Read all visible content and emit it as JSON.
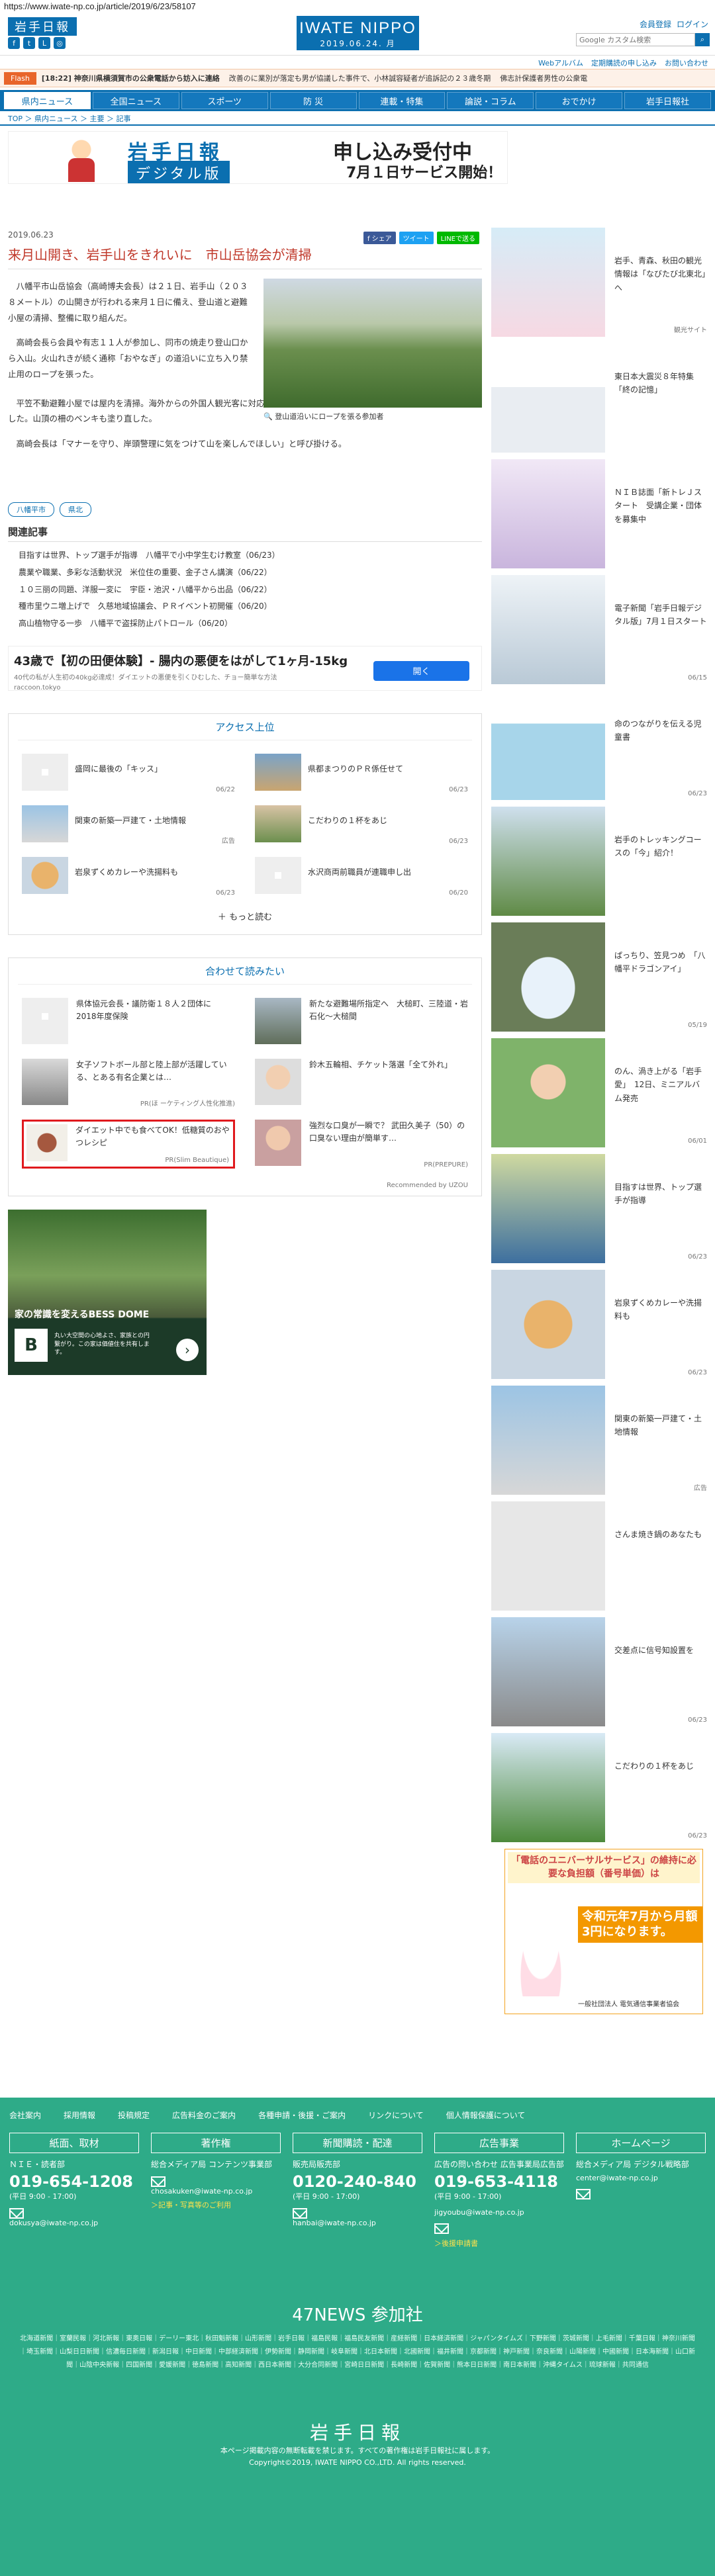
{
  "url": "https://www.iwate-np.co.jp/article/2019/6/23/58107",
  "header": {
    "logo": "岩手日報",
    "brand": "IWATE NIPPO",
    "brand_date": "2019.06.24. 月",
    "links": [
      "会員登録",
      "ログイン"
    ],
    "search_placeholder": "Google カスタム検索",
    "sub_links": [
      "Webアルバム",
      "定期購読の申し込み",
      "お問い合わせ"
    ]
  },
  "flash": {
    "tag": "Flash",
    "items": [
      "[18:22] 神奈川県横須賀市の公衆電話から妨入に連絡",
      "改善のに業別が落定も男が協議した事件で、小林誠容疑者が追訴記の２３歳冬期",
      "佛志計保護者男性の公衆電"
    ]
  },
  "nav": [
    "県内ニュース",
    "全国ニュース",
    "スポーツ",
    "防 災",
    "連載・特集",
    "論説・コラム",
    "おでかけ",
    "岩手日報社"
  ],
  "breadcrumb": "TOP ＞ 県内ニュース ＞ 主要 ＞ 記事",
  "banner": {
    "logo": "岩手日報",
    "digital": "デジタル版",
    "main": "申し込み受付中",
    "sub": "7月１日サービス開始！"
  },
  "article": {
    "date": "2019.06.23",
    "share": [
      "f シェア",
      "ツイート",
      "LINEで送る"
    ],
    "title": "来月山開き、岩手山をきれいに　市山岳協会が清掃",
    "caption": "登山道沿いにロープを張る参加者",
    "paragraphs": [
      "　八幡平市山岳協会（高崎博夫会長）は２１日、岩手山（２０３８メートル）の山開きが行われる来月１日に備え、登山道と避難小屋の清掃、整備に取り組んだ。",
      "　高崎会長ら会員や有志１１人が参加し、同市の焼走り登山口から入山。火山れきが続く通称「おやなぎ」の道沿いに立ち入り禁止用のロープを張った。",
      "　平笠不動避難小屋では屋内を清掃。海外からの外国人観光客に対応するため、ごみの持ち帰りを呼び掛ける多言語看板も設置した。山頂の柵のベンキも塗り直した。",
      "　高崎会長は「マナーを守り、岸頭警理に気をつけて山を楽しんでほしい」と呼び掛ける。"
    ],
    "tags": [
      "八幡平市",
      "県北"
    ]
  },
  "related": {
    "heading": "関連記事",
    "items": [
      "目指すは世界、トップ選手が指導　八幡平で小中学生むけ教室（06/23）",
      "農業や職業、多彩な活動状況　米位住の重要、金子さん講演（06/22）",
      "１０三丽の同題、洋服一変に　宇臣・池沢・八幡平から出品（06/22）",
      "種市里ウニ増上げで　久慈地域協議会、ＰＲイベント初開催（06/20）",
      "高山植物守る一歩　八幡平で盗採防止パトロール（06/20）"
    ]
  },
  "ad1": {
    "headline": "43歳で【初の田便体験】- 腸内の悪便をはがして1ヶ月-15kg",
    "sub": "40代の私が人生初の40kg必達成！ダイエットの悪便を引くひむした、チョー簡単な方法",
    "source": "raccoon.tokyo",
    "button": "開く"
  },
  "access": {
    "heading": "アクセス上位",
    "items": [
      {
        "title": "盛岡に最後の「キッス」",
        "date": "06/22"
      },
      {
        "title": "県都まつりのＰＲ係任せて",
        "date": "06/23"
      },
      {
        "title": "関東の新築一戸建て・土地情報",
        "date": "広告"
      },
      {
        "title": "こだわりの１杯をあじ",
        "date": "06/23"
      },
      {
        "title": "岩泉ずくめカレーや洗揚料も",
        "date": "06/23"
      },
      {
        "title": "水沢商両前職員が連職申し出",
        "date": "06/20"
      }
    ],
    "more": "もっと読む"
  },
  "recs": {
    "heading": "合わせて読みたい",
    "items": [
      {
        "title": "県体協元会長・議防衛１８人２団体に　2018年度保険",
        "p": ""
      },
      {
        "title": "新たな避難場所指定へ　大槌町、三陸道・岩石化～大槌間",
        "p": ""
      },
      {
        "title": "女子ソフトボール部と陸上部が活躍している、とある有名企業とは…",
        "p": "PR(ほ ーケティング人性化推進)"
      },
      {
        "title": "鈴木五輪相、チケット落選「全て外れ」",
        "p": ""
      },
      {
        "title": "ダイエット中でも食べてOK！低糖質のおやつレシピ",
        "p": "PR(Slim Beautique)"
      },
      {
        "title": "強烈な口臭が一瞬で？ 武田久美子（50）の口臭ない理由が簡単す…",
        "p": "PR(PREPURE)"
      }
    ],
    "by": "Recommended by UZOU"
  },
  "bess": {
    "headline": "家の常識を変えるBESS DOME",
    "logo": "B",
    "sub": "丸い大空間の心地よさ、家族との円繋がり。この家は価値住を共有します。"
  },
  "sidebar": [
    {
      "title": "岩手、青森、秋田の観光情報は「なびたび北東北」へ",
      "date": "観光サイト"
    },
    {
      "title": "東日本大震災８年特集「終の記憶」",
      "date": ""
    },
    {
      "title": "ＮＩＢ誌面「新トレＪスタート　受講企業・団体を募集中",
      "date": ""
    },
    {
      "title": "電子新聞「岩手日報デジタル版」7月１日スタート",
      "date": "06/15"
    },
    {
      "title": "命のつながりを伝える児童書",
      "date": "06/23"
    },
    {
      "title": "岩手のトレッキングコースの「今」紹介！",
      "date": ""
    },
    {
      "title": "ぱっちり、笠見つめ　「八幡平ドラゴンアイ」",
      "date": "05/19"
    },
    {
      "title": "のん、渦き上がる「岩手愛」　12日、ミニアルバム発売",
      "date": "06/01"
    },
    {
      "title": "目指すは世界、トップ選手が指導",
      "date": "06/23"
    },
    {
      "title": "岩泉ずくめカレーや洗揚料も",
      "date": "06/23"
    },
    {
      "title": "関東の新築一戸建て・土地情報",
      "date": "広告"
    },
    {
      "title": "さんま焼き鍋のあなたも",
      "date": ""
    },
    {
      "title": "交差点に信号知設置を",
      "date": "06/23"
    },
    {
      "title": "こだわりの１杯をあじ",
      "date": "06/23"
    }
  ],
  "side_ad": {
    "headline": "「電話のユニバーサルサービス」の維持に必要な負担額（番号単価）は",
    "big": "令和元年7月から月額3円になります。",
    "note": "一般社団法人 電気通信事業者協会"
  },
  "footer": {
    "links": [
      "会社案内",
      "採用情報",
      "投稿規定",
      "広告料金のご案内",
      "各種申請・後援・ご案内",
      "リンクについて",
      "個人情報保護について"
    ],
    "cols": [
      {
        "h": "紙面、取材",
        "l": "ＮＩＥ・読者部",
        "tel": "019-654-1208",
        "hours": "(平日 9:00 - 17:00)",
        "mail": "dokusya@iwate-np.co.jp",
        "y": ""
      },
      {
        "h": "著作権",
        "l": "総合メディア局 コンテンツ事業部",
        "tel": "",
        "hours": "",
        "mail": "chosakuken@iwate-np.co.jp",
        "y": "＞記事・写真等のご利用"
      },
      {
        "h": "新聞購読・配達",
        "l": "販売局販売部",
        "tel": "0120-240-840",
        "hours": "(平日 9:00 - 17:00)",
        "mail": "hanbai@iwate-np.co.jp",
        "y": ""
      },
      {
        "h": "広告事業",
        "l": "広告の問い合わせ 広告事業局広告部",
        "tel": "019-653-4118",
        "hours": "(平日 9:00 - 17:00)",
        "mail": "jigyoubu@iwate-np.co.jp",
        "y": "＞後援申請書"
      },
      {
        "h": "ホームページ",
        "l": "総合メディア局 デジタル戦略部",
        "tel": "",
        "hours": "",
        "mail": "center@iwate-np.co.jp",
        "y": ""
      }
    ],
    "n47": "47NEWS 参加社",
    "n47list": "北海道新聞｜室蘭民報｜河北新報｜東奥日報｜デーリー東北｜秋田魁新報｜山形新聞｜岩手日報｜福島民報｜福島民友新聞｜産経新聞｜日本経済新聞｜ジャパンタイムズ｜下野新聞｜茨城新聞｜上毛新聞｜千葉日報｜神奈川新聞｜埼玉新聞｜山梨日日新聞｜信濃毎日新聞｜新潟日報｜中日新聞｜中部経済新聞｜伊勢新聞｜静岡新聞｜岐阜新聞｜北日本新聞｜北國新聞｜福井新聞｜京都新聞｜神戸新聞｜奈良新聞｜山陽新聞｜中國新聞｜日本海新聞｜山口新聞｜山陰中央新報｜四国新聞｜愛媛新聞｜徳島新聞｜高知新聞｜西日本新聞｜大分合同新聞｜宮崎日日新聞｜長崎新聞｜佐賀新聞｜熊本日日新聞｜南日本新聞｜沖縄タイムス｜琉球新報｜共同通信",
    "logo": "岩手日報",
    "copy1": "本ページ掲載内容の無断転載を禁じます。すべての著作権は岩手日報社に属します。",
    "copy2": "Copyright©2019, IWATE NIPPO CO.,LTD. All rights reserved."
  }
}
